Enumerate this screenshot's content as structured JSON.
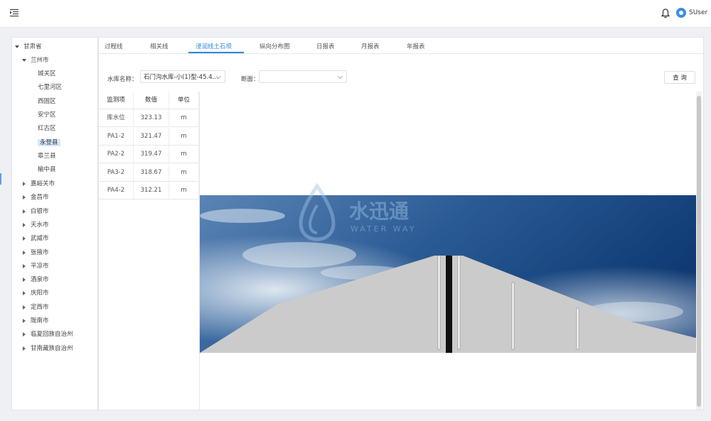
{
  "header": {
    "menu_icon": "menu-fold-icon",
    "bell_icon": "bell-icon",
    "username": "SUser"
  },
  "tree": {
    "root": "甘肃省",
    "city": "兰州市",
    "districts": [
      "城关区",
      "七里河区",
      "西固区",
      "安宁区",
      "红古区",
      "永登县",
      "皋兰县",
      "榆中县"
    ],
    "selected_district": "永登县",
    "other_cities": [
      "嘉峪关市",
      "金昌市",
      "白银市",
      "天水市",
      "武威市",
      "张掖市",
      "平凉市",
      "酒泉市",
      "庆阳市",
      "定西市",
      "陇南市",
      "临夏回族自治州",
      "甘南藏族自治州"
    ]
  },
  "tabs": [
    "过程线",
    "相关线",
    "浸润线土石坝",
    "纵向分布图",
    "日报表",
    "月报表",
    "年报表"
  ],
  "active_tab": "浸润线土石坝",
  "filters": {
    "reservoir_label": "水库名称：",
    "reservoir_value": "石门沟水库-小(1)型-45.4...",
    "section_label": "断面：",
    "section_value": "",
    "query_button": "查 询"
  },
  "table": {
    "headers": [
      "监测项",
      "数值",
      "单位"
    ],
    "rows": [
      [
        "库水位",
        "323.13",
        "m"
      ],
      [
        "PA1-2",
        "321.47",
        "m"
      ],
      [
        "PA2-2",
        "319.47",
        "m"
      ],
      [
        "PA3-2",
        "318.67",
        "m"
      ],
      [
        "PA4-2",
        "312.21",
        "m"
      ]
    ]
  },
  "watermark": {
    "cn": "水迅通",
    "en": "WATER WAY"
  }
}
